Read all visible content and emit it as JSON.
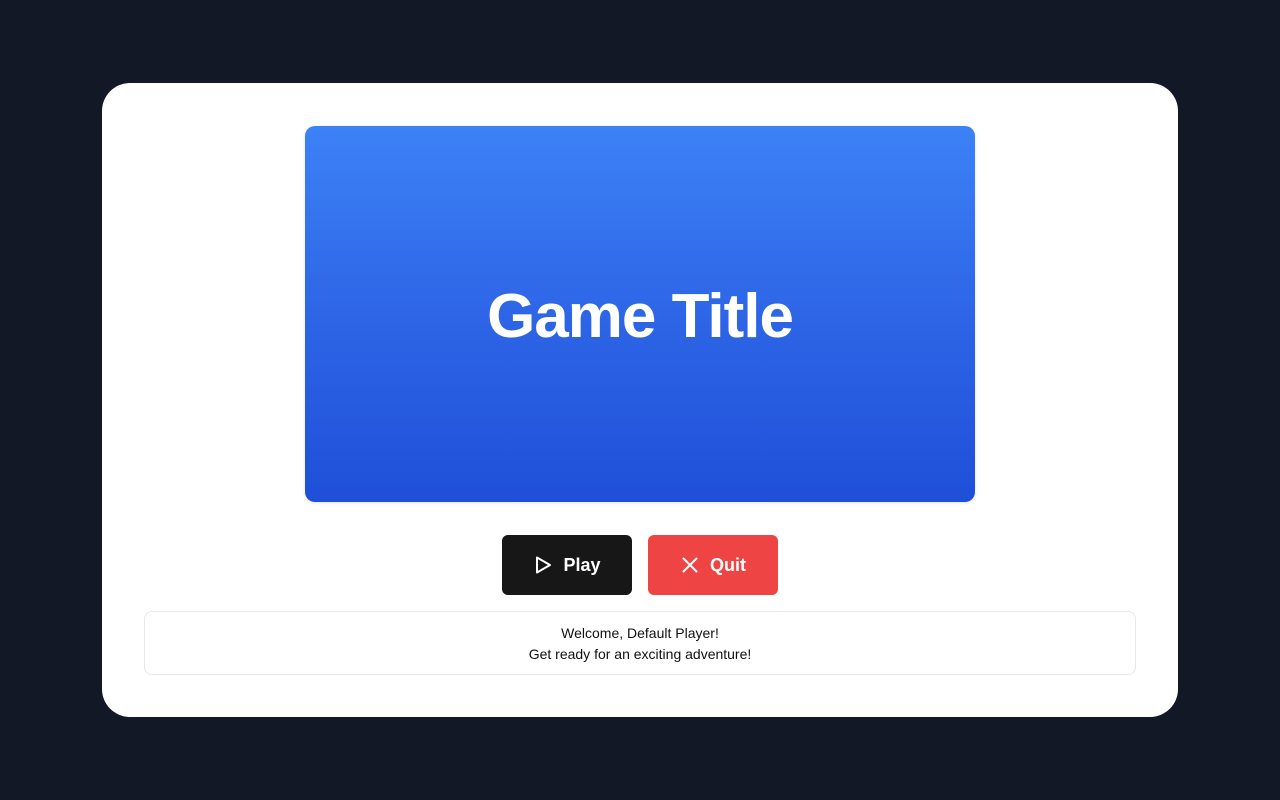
{
  "hero": {
    "title": "Game Title",
    "gradient_top": "#3d82f6",
    "gradient_bottom": "#1f4fd8"
  },
  "buttons": {
    "play": {
      "label": "Play",
      "icon": "play-icon",
      "color": "#171717"
    },
    "quit": {
      "label": "Quit",
      "icon": "close-icon",
      "color": "#ef4444"
    }
  },
  "message": {
    "welcome": "Welcome, Default Player!",
    "subtitle": "Get ready for an exciting adventure!"
  },
  "colors": {
    "background": "#121826",
    "card": "#ffffff"
  }
}
